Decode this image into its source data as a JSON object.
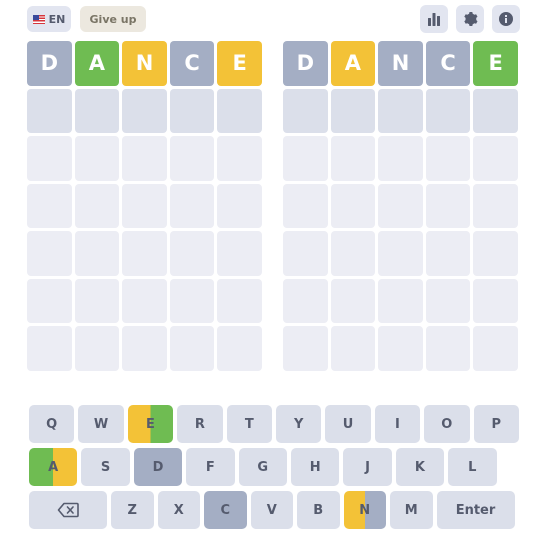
{
  "header": {
    "language_label": "EN",
    "give_up_label": "Give up",
    "icons": [
      "stats-icon",
      "settings-gear-icon",
      "info-icon"
    ]
  },
  "colors": {
    "gray": "#a4aec4",
    "green": "#6fbc52",
    "yellow": "#f3c237",
    "empty": "#ecedf4",
    "key": "#dbdfea"
  },
  "boards": [
    {
      "guesses": [
        {
          "word": [
            "D",
            "A",
            "N",
            "C",
            "E"
          ],
          "states": [
            "gray",
            "green",
            "yellow",
            "gray",
            "yellow"
          ]
        }
      ]
    },
    {
      "guesses": [
        {
          "word": [
            "D",
            "A",
            "N",
            "C",
            "E"
          ],
          "states": [
            "gray",
            "yellow",
            "gray",
            "gray",
            "green"
          ]
        }
      ]
    }
  ],
  "keyboard": {
    "row1": [
      "Q",
      "W",
      "E",
      "R",
      "T",
      "Y",
      "U",
      "I",
      "O",
      "P"
    ],
    "row2": [
      "A",
      "S",
      "D",
      "F",
      "G",
      "H",
      "J",
      "K",
      "L"
    ],
    "row3": [
      "Z",
      "X",
      "C",
      "V",
      "B",
      "N",
      "M"
    ],
    "enter_label": "Enter",
    "backspace_icon": "backspace-icon"
  }
}
